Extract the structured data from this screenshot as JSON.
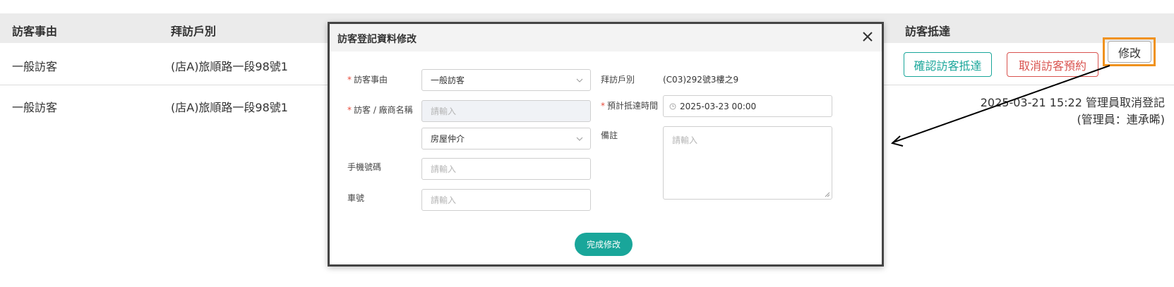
{
  "table": {
    "headers": [
      "訪客事由",
      "拜訪戶別",
      "訪客抵達"
    ],
    "rows": [
      {
        "reason": "一般訪客",
        "unit": "(店A)旅順路一段98號1"
      },
      {
        "reason": "一般訪客",
        "unit": "(店A)旅順路一段98號1"
      }
    ],
    "actions": {
      "confirm": "確認訪客抵達",
      "cancel": "取消訪客預約",
      "edit": "修改"
    },
    "log_line1": "2025-03-21 15:22 管理員取消登記",
    "log_line2": "(管理員：連承晞)"
  },
  "modal": {
    "title": "訪客登記資料修改",
    "fields": {
      "reason_label": "訪客事由",
      "reason_value": "一般訪客",
      "name_label": "訪客 / 廠商名稱",
      "name_placeholder": "請輸入",
      "category_value": "房屋仲介",
      "phone_label": "手機號碼",
      "phone_placeholder": "請輸入",
      "plate_label": "車號",
      "plate_placeholder": "請輸入",
      "unit_label": "拜訪戶別",
      "unit_value": "(C03)292號3樓之9",
      "eta_label": "預計抵達時間",
      "eta_value": "2025-03-23 00:00",
      "note_label": "備註",
      "note_placeholder": "請輸入"
    },
    "submit_label": "完成修改"
  },
  "colors": {
    "accent": "#19a69a",
    "danger": "#d9534f",
    "highlight": "#f0921e"
  }
}
